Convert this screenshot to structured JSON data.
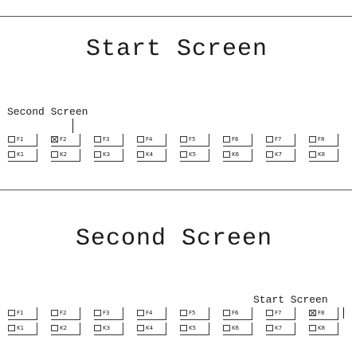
{
  "screens": [
    {
      "title": "Start Screen",
      "hint": "Second Screen",
      "f_keys": [
        {
          "label": "F1",
          "checked": false
        },
        {
          "label": "F2",
          "checked": true
        },
        {
          "label": "F3",
          "checked": false
        },
        {
          "label": "F4",
          "checked": false
        },
        {
          "label": "F5",
          "checked": false
        },
        {
          "label": "F6",
          "checked": false
        },
        {
          "label": "F7",
          "checked": false
        },
        {
          "label": "F8",
          "checked": false
        }
      ],
      "k_keys": [
        {
          "label": "K1",
          "checked": false
        },
        {
          "label": "K2",
          "checked": false
        },
        {
          "label": "K3",
          "checked": false
        },
        {
          "label": "K4",
          "checked": false
        },
        {
          "label": "K5",
          "checked": false
        },
        {
          "label": "K6",
          "checked": false
        },
        {
          "label": "K7",
          "checked": false
        },
        {
          "label": "K8",
          "checked": false
        }
      ]
    },
    {
      "title": "Second Screen",
      "hint": "Start Screen",
      "f_keys": [
        {
          "label": "F1",
          "checked": false
        },
        {
          "label": "F2",
          "checked": false
        },
        {
          "label": "F3",
          "checked": false
        },
        {
          "label": "F4",
          "checked": false
        },
        {
          "label": "F5",
          "checked": false
        },
        {
          "label": "F6",
          "checked": false
        },
        {
          "label": "F7",
          "checked": false
        },
        {
          "label": "F8",
          "checked": true
        }
      ],
      "k_keys": [
        {
          "label": "K1",
          "checked": false
        },
        {
          "label": "K2",
          "checked": false
        },
        {
          "label": "K3",
          "checked": false
        },
        {
          "label": "K4",
          "checked": false
        },
        {
          "label": "K5",
          "checked": false
        },
        {
          "label": "K6",
          "checked": false
        },
        {
          "label": "K7",
          "checked": false
        },
        {
          "label": "K8",
          "checked": false
        }
      ]
    }
  ]
}
